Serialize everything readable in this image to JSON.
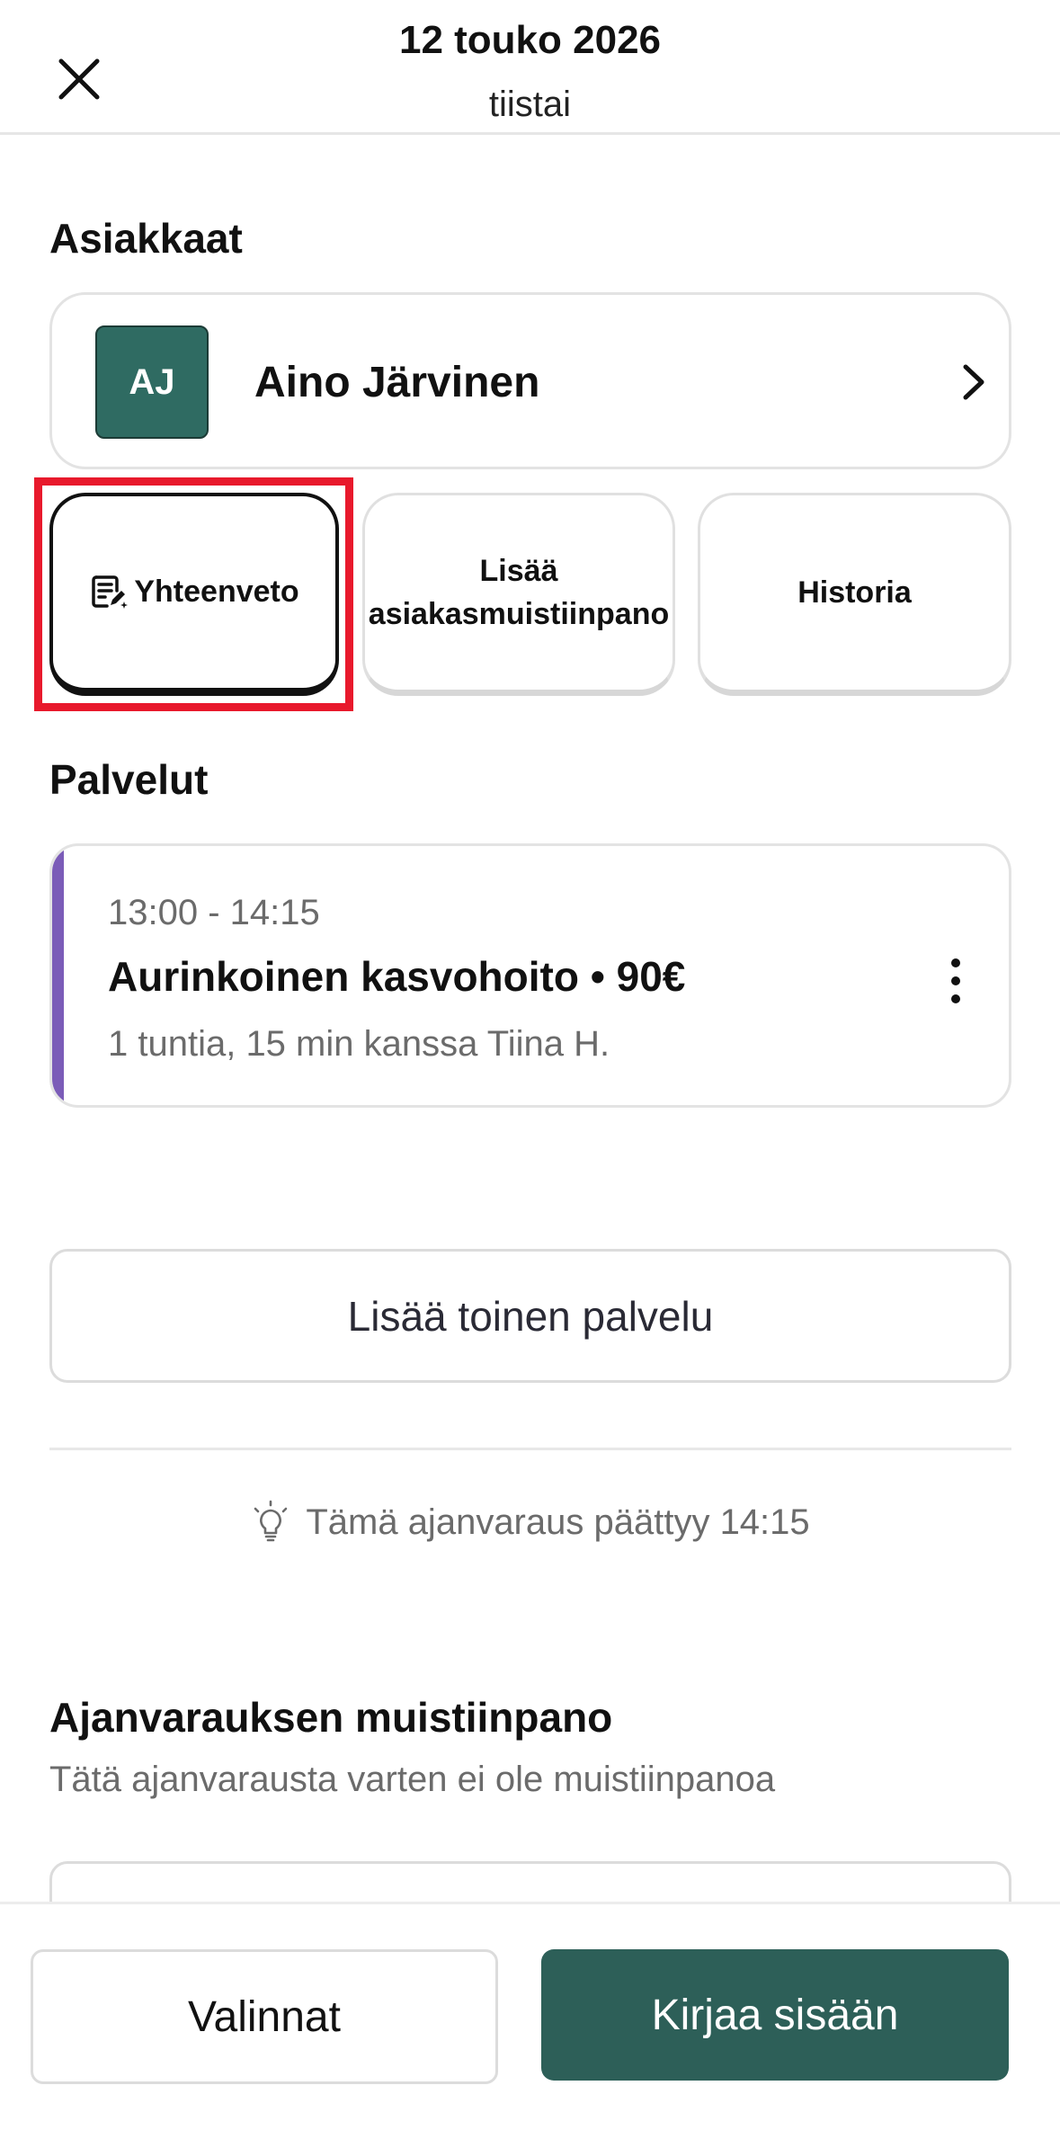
{
  "header": {
    "date": "12 touko 2026",
    "weekday": "tiistai"
  },
  "clients_section": {
    "title": "Asiakkaat",
    "client": {
      "initials": "AJ",
      "name": "Aino Järvinen",
      "avatar_color": "#2f6b62"
    }
  },
  "actions": {
    "summary": "Yhteenveto",
    "add_note": "Lisää asiakasmuistiinpano",
    "history": "Historia"
  },
  "services_section": {
    "title": "Palvelut",
    "service": {
      "time": "13:00 - 14:15",
      "name": "Aurinkoinen kasvohoito • 90€",
      "details": "1 tuntia, 15 min kanssa Tiina H.",
      "accent_color": "#7b5cb8"
    },
    "add_service_label": "Lisää toinen palvelu"
  },
  "info": {
    "message": "Tämä ajanvaraus päättyy 14:15"
  },
  "appointment_note": {
    "title": "Ajanvarauksen muistiinpano",
    "empty_text": "Tätä ajanvarausta varten ei ole muistiinpanoa"
  },
  "footer": {
    "options_label": "Valinnat",
    "checkin_label": "Kirjaa sisään",
    "primary_color": "#2d5f58"
  },
  "icons": {
    "close": "close-icon",
    "chevron": "chevron-right-icon",
    "summary": "note-edit-icon",
    "more": "more-vertical-icon",
    "lightbulb": "lightbulb-icon"
  }
}
